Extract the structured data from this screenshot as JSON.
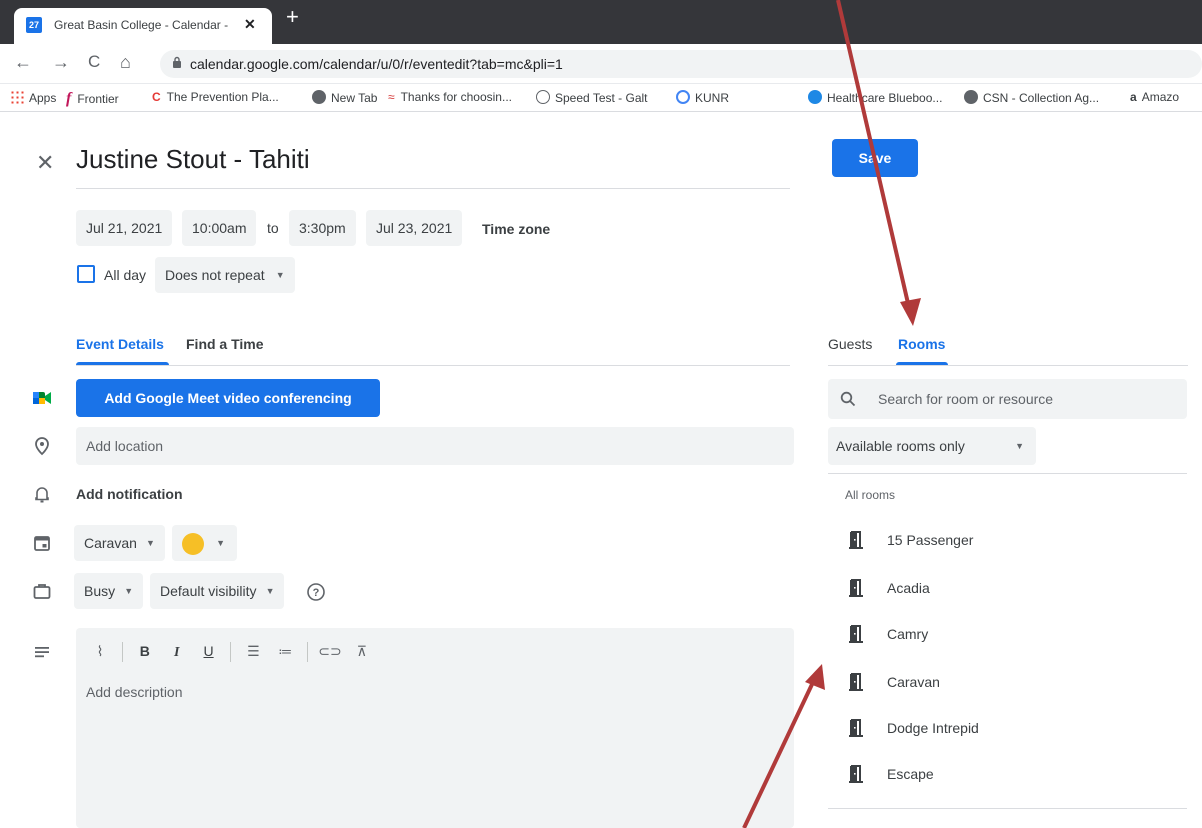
{
  "browser": {
    "tab_title": "Great Basin College - Calendar - ",
    "tab_favicon_text": "27",
    "url": "calendar.google.com/calendar/u/0/r/eventedit?tab=mc&pli=1",
    "bookmarks": [
      {
        "label": "Apps",
        "icon": "apps-grid-icon",
        "color": "#ea4335"
      },
      {
        "label": "Frontier",
        "icon": "frontier-f-icon",
        "color": "#c2185b"
      },
      {
        "label": "The Prevention Pla...",
        "icon": "prevention-logo-icon",
        "color": "#e53935"
      },
      {
        "label": "New Tab",
        "icon": "globe-icon",
        "color": "#5f6368"
      },
      {
        "label": "Thanks for choosin...",
        "icon": "swoosh-icon",
        "color": "#d32f2f"
      },
      {
        "label": "Speed Test - Galt",
        "icon": "gauge-icon",
        "color": "#5f6368"
      },
      {
        "label": "KUNR",
        "icon": "radio-icon",
        "color": "#4285f4"
      },
      {
        "label": "Healthcare Blueboo...",
        "icon": "bluebook-icon",
        "color": "#1e88e5"
      },
      {
        "label": "CSN - Collection Ag...",
        "icon": "globe-icon",
        "color": "#5f6368"
      },
      {
        "label": "Amazo",
        "icon": "amazon-icon",
        "color": "#000000"
      }
    ]
  },
  "event": {
    "title": "Justine Stout - Tahiti",
    "start_date": "Jul 21, 2021",
    "start_time": "10:00am",
    "to_label": "to",
    "end_time": "3:30pm",
    "end_date": "Jul 23, 2021",
    "time_zone_label": "Time zone",
    "all_day_label": "All day",
    "repeat_label": "Does not repeat",
    "save_label": "Save"
  },
  "left_tabs": {
    "event_details": "Event Details",
    "find_time": "Find a Time"
  },
  "details": {
    "meet_button": "Add Google Meet video conferencing",
    "location_placeholder": "Add location",
    "notification_label": "Add notification",
    "calendar": "Caravan",
    "color": "#f6bf26",
    "busy": "Busy",
    "visibility": "Default visibility",
    "description_placeholder": "Add description"
  },
  "right_tabs": {
    "guests": "Guests",
    "rooms": "Rooms"
  },
  "rooms_panel": {
    "search_placeholder": "Search for room or resource",
    "filter": "Available rooms only",
    "section_label": "All rooms",
    "rooms": [
      "15 Passenger",
      "Acadia",
      "Camry",
      "Caravan",
      "Dodge Intrepid",
      "Escape"
    ]
  },
  "colors": {
    "accent": "#1a73e8",
    "arrow": "#b03a3a"
  }
}
